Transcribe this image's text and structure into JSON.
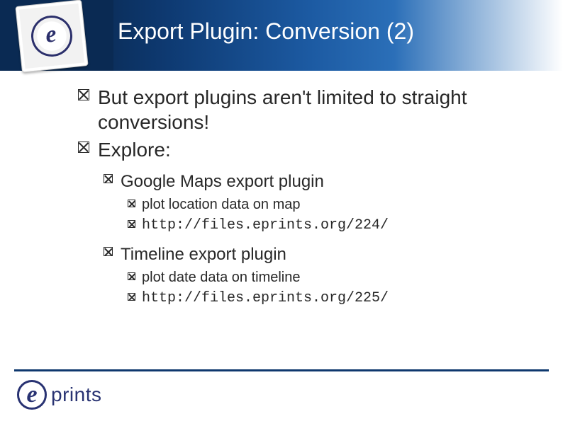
{
  "header": {
    "title": "Export Plugin: Conversion (2)",
    "logo_letter": "e"
  },
  "bullets": {
    "b1": "But export plugins aren't limited to straight conversions!",
    "b2": "Explore:",
    "g_maps": "Google Maps export plugin",
    "g_maps_sub1": "plot location data on map",
    "g_maps_sub2": "http://files.eprints.org/224/",
    "timeline": "Timeline export plugin",
    "timeline_sub1": "plot date data on timeline",
    "timeline_sub2": "http://files.eprints.org/225/"
  },
  "footer": {
    "logo_e": "e",
    "logo_text": "prints"
  }
}
